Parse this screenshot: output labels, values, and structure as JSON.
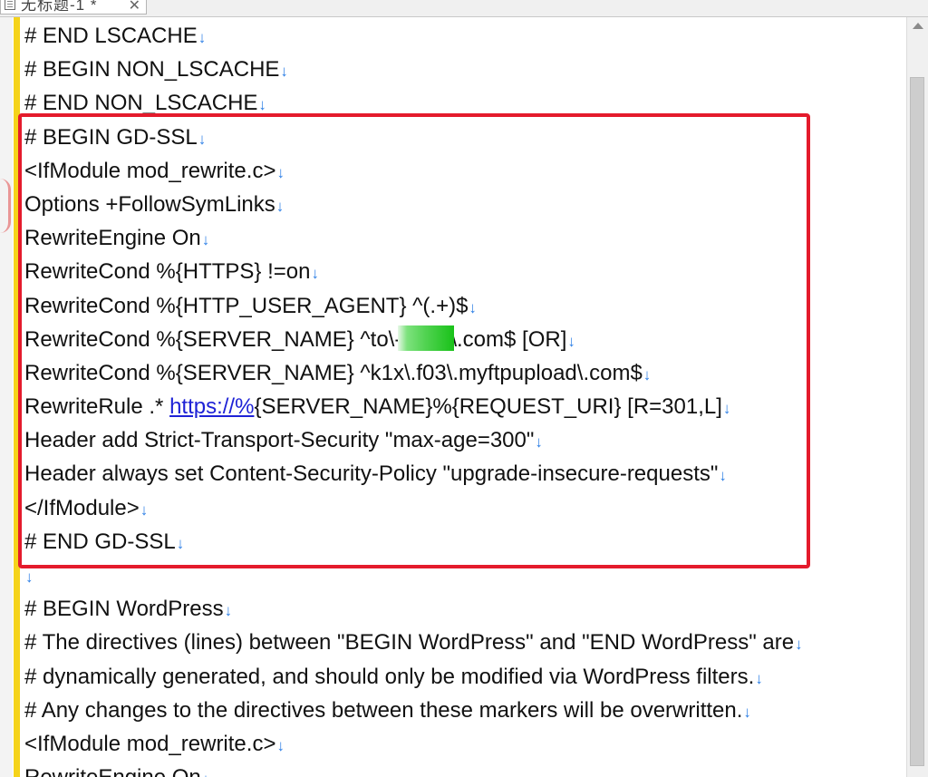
{
  "tab": {
    "title": "无标题-1 *",
    "close": "✕"
  },
  "eol_marker": "↓",
  "colors": {
    "highlight_box": "#e41b2c",
    "eol_marker": "#2f80e6",
    "gutter": "#f5d31a"
  },
  "lines": [
    {
      "text": "# END LSCACHE"
    },
    {
      "text": "# BEGIN NON_LSCACHE"
    },
    {
      "text": "# END NON_LSCACHE"
    },
    {
      "text": "# BEGIN GD-SSL"
    },
    {
      "text": "<IfModule mod_rewrite.c>"
    },
    {
      "text": "Options +FollowSymLinks"
    },
    {
      "text": "RewriteEngine On"
    },
    {
      "text": "RewriteCond %{HTTPS} !=on"
    },
    {
      "text": "RewriteCond %{HTTP_USER_AGENT} ^(.+)$"
    },
    {
      "text": "RewriteCond %{SERVER_NAME} ^to\\-",
      "redacted": true,
      "after": "\\.com$ [OR]"
    },
    {
      "text": "RewriteCond %{SERVER_NAME} ^k1x\\.f03\\.myftpupload\\.com$"
    },
    {
      "text": "RewriteRule .* ",
      "link": "https://%",
      "after": "{SERVER_NAME}%{REQUEST_URI} [R=301,L]"
    },
    {
      "text": "Header add Strict-Transport-Security \"max-age=300\""
    },
    {
      "text": "Header always set Content-Security-Policy \"upgrade-insecure-requests\""
    },
    {
      "text": "</IfModule>"
    },
    {
      "text": "# END GD-SSL"
    },
    {
      "text": ""
    },
    {
      "text": "# BEGIN WordPress"
    },
    {
      "text": "# The directives (lines) between \"BEGIN WordPress\" and \"END WordPress\" are"
    },
    {
      "text": "# dynamically generated, and should only be modified via WordPress filters."
    },
    {
      "text": "# Any changes to the directives between these markers will be overwritten."
    },
    {
      "text": "<IfModule mod_rewrite.c>"
    },
    {
      "text": "RewriteEngine On"
    }
  ]
}
